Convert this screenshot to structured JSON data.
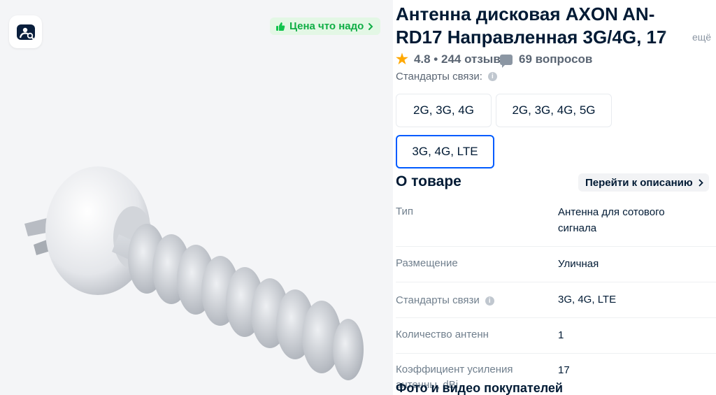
{
  "gallery": {
    "price_badge": "Цена что надо",
    "icons": {
      "search_by_photo": "photo-search-icon",
      "thumbs_up": "thumbs-up-icon",
      "chevron": "chevron-right-icon"
    },
    "colors": {
      "badge_bg": "#e3f7e5",
      "badge_text": "#10c44c"
    }
  },
  "product": {
    "title_line1": "Антенна дисковая AXON AN-",
    "title_line2": "RD17 Направленная 3G/4G, 17",
    "more_link": "ещё",
    "rating": "4.8",
    "reviews": "244 отзыва",
    "questions": "69 вопросов"
  },
  "standards": {
    "label": "Стандарты связи:",
    "options": [
      "2G, 3G, 4G",
      "2G, 3G, 4G, 5G",
      "3G, 4G, LTE"
    ],
    "selected": "3G, 4G, LTE"
  },
  "about": {
    "title": "О товаре",
    "goto_description": "Перейти к описанию",
    "specs": [
      {
        "key": "Тип",
        "value": "Антенна для сотового сигнала"
      },
      {
        "key": "Размещение",
        "value": "Уличная"
      },
      {
        "key": "Стандарты связи",
        "value": "3G, 4G, LTE"
      },
      {
        "key": "Количество антенн",
        "value": "1"
      },
      {
        "key": "Коэффициент усиления антенны, dBi",
        "value": "17"
      }
    ]
  },
  "photos_section": {
    "title": "Фото и видео покупателей"
  },
  "colors": {
    "accent": "#005bff",
    "text": "#001a34",
    "muted": "#707f8d",
    "star": "#ffa800"
  }
}
